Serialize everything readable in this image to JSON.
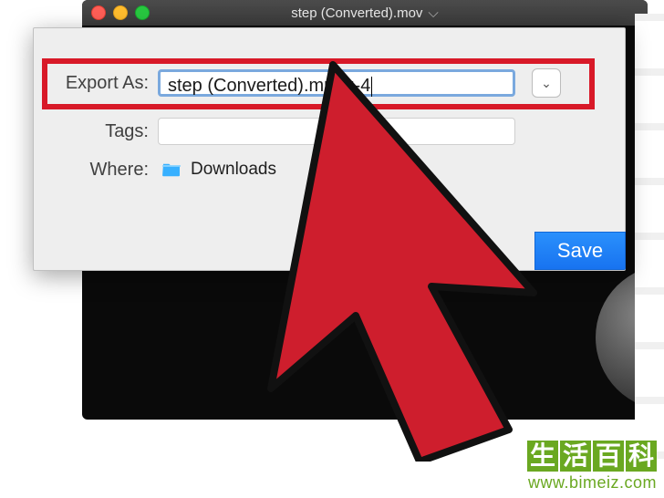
{
  "titlebar": {
    "title": "step (Converted).mov"
  },
  "sheet": {
    "exportAs": {
      "label": "Export As:",
      "value": "step (Converted).mpeg-4"
    },
    "tags": {
      "label": "Tags:",
      "value": ""
    },
    "where": {
      "label": "Where:",
      "value": "Downloads"
    },
    "saveLabel": "Save"
  },
  "watermark": {
    "chars": [
      "生",
      "活",
      "百",
      "科"
    ],
    "url": "www.bimeiz.com"
  }
}
